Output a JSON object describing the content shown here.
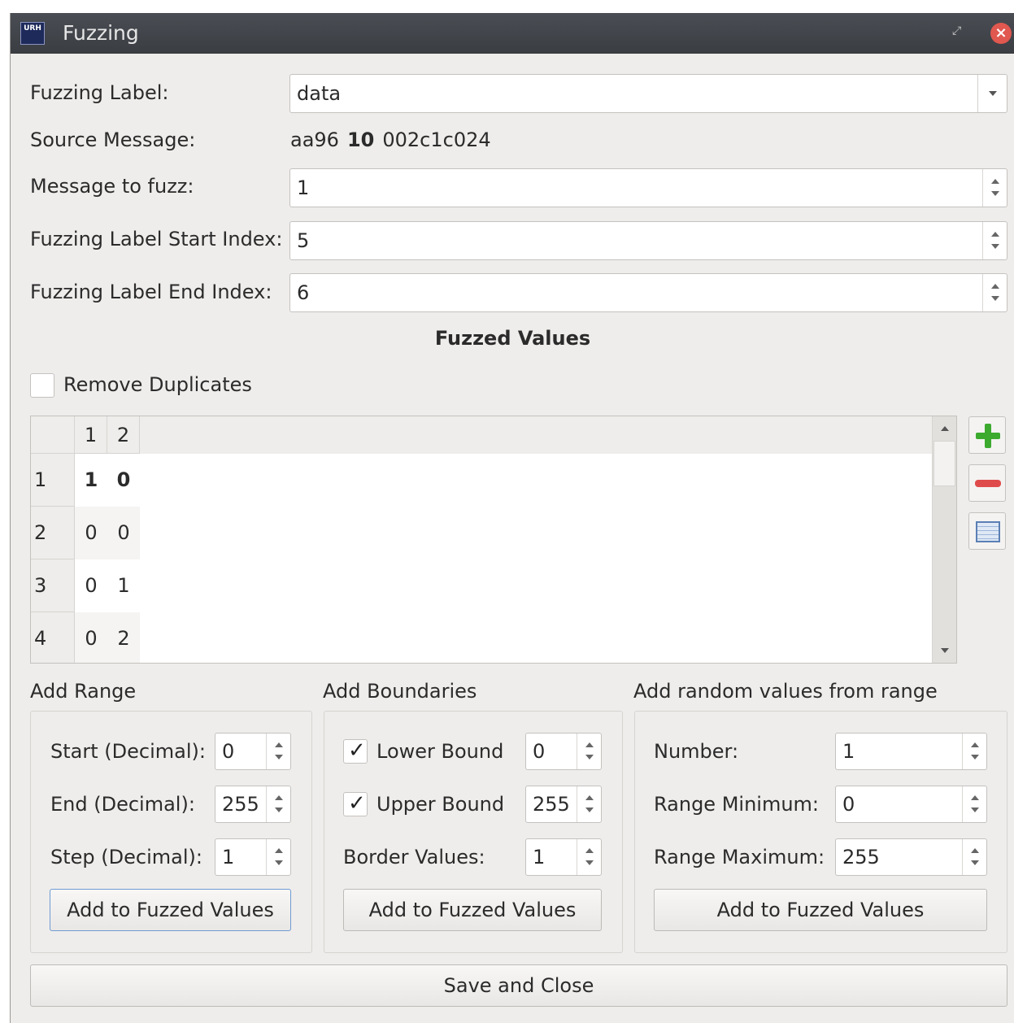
{
  "window": {
    "title": "Fuzzing",
    "app_icon_text": "URH"
  },
  "form": {
    "fuzzing_label": {
      "label": "Fuzzing Label:",
      "value": "data"
    },
    "source_message": {
      "label": "Source Message:",
      "prefix": "aa96",
      "highlight": "10",
      "suffix": "002c1c024"
    },
    "message_to_fuzz": {
      "label": "Message to fuzz:",
      "value": "1"
    },
    "start_index": {
      "label": "Fuzzing Label Start Index:",
      "value": "5"
    },
    "end_index": {
      "label": "Fuzzing Label End Index:",
      "value": "6"
    }
  },
  "fuzzed_values": {
    "title": "Fuzzed Values",
    "remove_duplicates_label": "Remove Duplicates",
    "remove_duplicates_checked": false,
    "columns": [
      "1",
      "2"
    ],
    "rows": [
      {
        "header": "1",
        "cells": [
          "1",
          "0"
        ]
      },
      {
        "header": "2",
        "cells": [
          "0",
          "0"
        ]
      },
      {
        "header": "3",
        "cells": [
          "0",
          "1"
        ]
      },
      {
        "header": "4",
        "cells": [
          "0",
          "2"
        ]
      }
    ]
  },
  "add_range": {
    "title": "Add Range",
    "start_label": "Start (Decimal):",
    "start_value": "0",
    "end_label": "End (Decimal):",
    "end_value": "255",
    "step_label": "Step (Decimal):",
    "step_value": "1",
    "button": "Add to Fuzzed Values"
  },
  "add_boundaries": {
    "title": "Add Boundaries",
    "lower_label": "Lower Bound",
    "lower_checked": true,
    "lower_value": "0",
    "upper_label": "Upper Bound",
    "upper_checked": true,
    "upper_value": "255",
    "border_label": "Border Values:",
    "border_value": "1",
    "button": "Add to Fuzzed Values"
  },
  "add_random": {
    "title": "Add random values from range",
    "number_label": "Number:",
    "number_value": "1",
    "min_label": "Range Minimum:",
    "min_value": "0",
    "max_label": "Range Maximum:",
    "max_value": "255",
    "button": "Add to Fuzzed Values"
  },
  "footer": {
    "save_label": "Save and Close"
  }
}
